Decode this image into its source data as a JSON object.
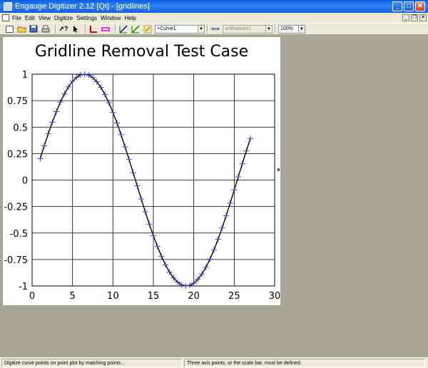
{
  "window": {
    "title": "Engauge Digitizer 2.12 [Qt] - [gridlines]",
    "minimize": "_",
    "maximize": "□",
    "close": "✕"
  },
  "menu": {
    "items": [
      "File",
      "Edit",
      "View",
      "Digitize",
      "Settings",
      "Window",
      "Help"
    ]
  },
  "toolbar": {
    "curve_combo": "Curve1",
    "measure_combo": "Measure1",
    "zoom_combo": "100%",
    "icons": [
      "new-icon",
      "open-icon",
      "save-icon",
      "print-icon",
      "whats-this-icon",
      "select-arrow-icon",
      "axis-point-icon",
      "scale-bar-icon",
      "curve-point-icon",
      "segment-fill-icon",
      "point-match-icon",
      "measure-icon"
    ]
  },
  "chart_data": {
    "type": "line",
    "title": "Gridline Removal Test Case",
    "xlabel": "",
    "ylabel": "",
    "xlim": [
      0,
      30
    ],
    "ylim": [
      -1,
      1
    ],
    "xticks": [
      0,
      5,
      10,
      15,
      20,
      25,
      30
    ],
    "yticks": [
      1,
      0.75,
      0.5,
      0.25,
      0,
      -0.25,
      -0.5,
      -0.75,
      -1
    ],
    "ytick_labels": [
      "1",
      "0.75",
      "0.5",
      "0.25",
      "0",
      "-0.25",
      "-0.5",
      "-0.75",
      "-1"
    ],
    "grid": true,
    "series": [
      {
        "function": "sin",
        "x_start": 1,
        "x_end": 27,
        "x_step": 0.5,
        "period": 25.2,
        "phase_x": 0.18,
        "line_color": "#000000",
        "marker": "+",
        "marker_color": "#3a3ad0"
      }
    ]
  },
  "status": {
    "left": "Digitize curve points on point plot by matching points...",
    "right": "Three axis points, or the scale bar, must be defined."
  }
}
